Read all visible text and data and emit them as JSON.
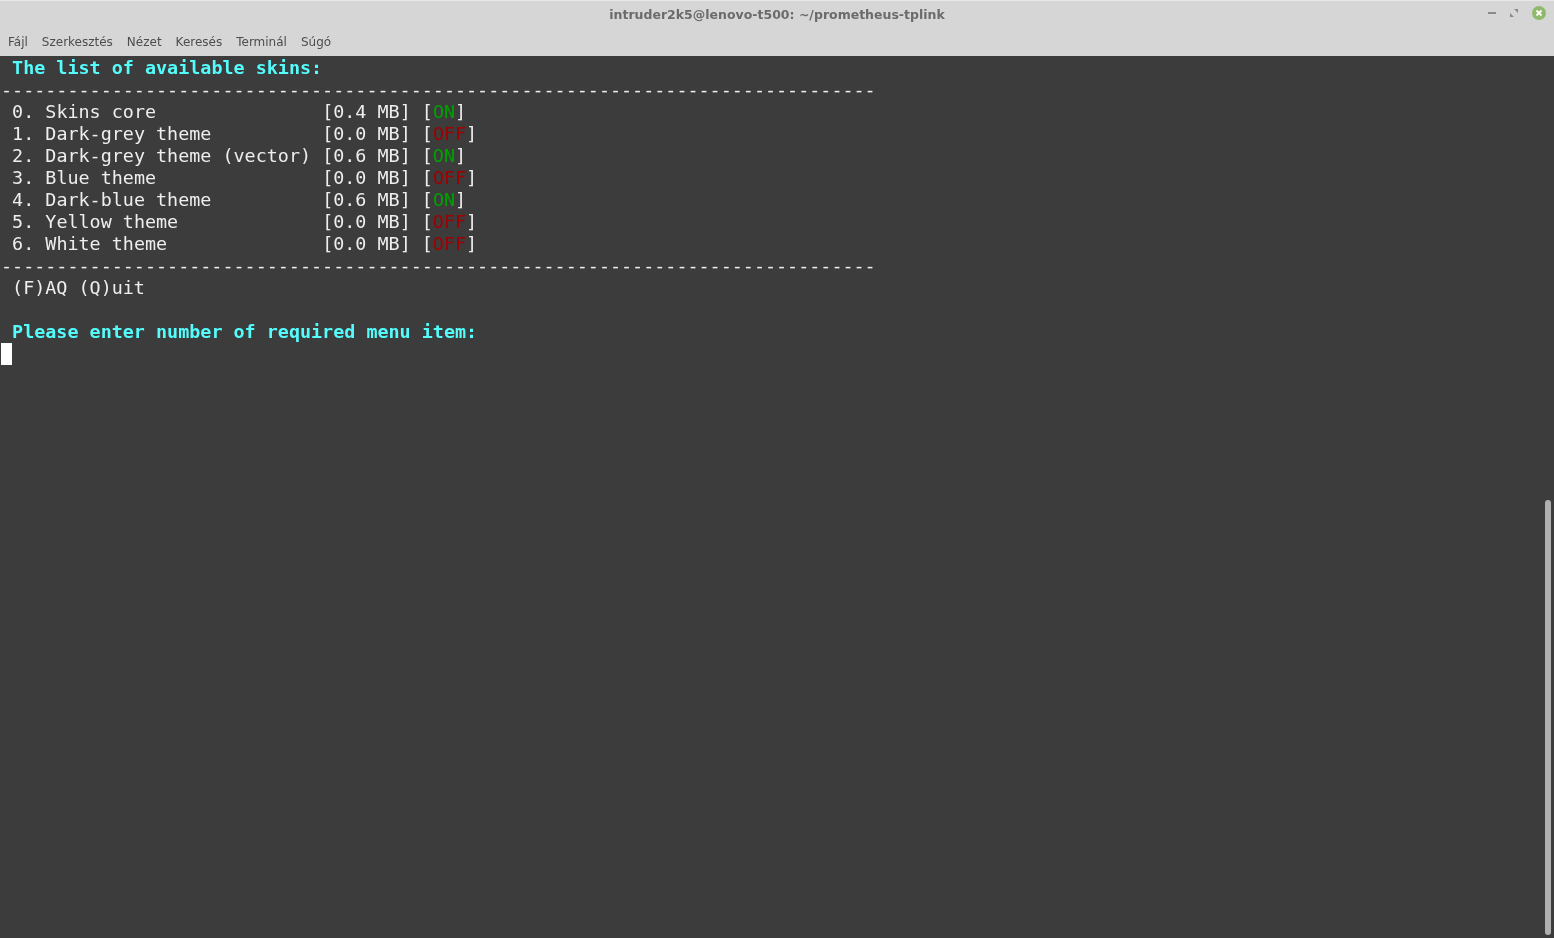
{
  "window": {
    "title": "intruder2k5@lenovo-t500: ~/prometheus-tplink"
  },
  "menu": [
    "Fájl",
    "Szerkesztés",
    "Nézet",
    "Keresés",
    "Terminál",
    "Súgó"
  ],
  "terminal": {
    "heading": "The list of available skins:",
    "separator": "-------------------------------------------------------------------------------",
    "skins": [
      {
        "number": "0.",
        "name": "Skins core",
        "size": "[0.4 MB]",
        "open": "[",
        "status": "ON",
        "close": "]",
        "on": true
      },
      {
        "number": "1.",
        "name": "Dark-grey theme",
        "size": "[0.0 MB]",
        "open": "[",
        "status": "OFF",
        "close": "]",
        "on": false
      },
      {
        "number": "2.",
        "name": "Dark-grey theme (vector)",
        "size": "[0.6 MB]",
        "open": "[",
        "status": "ON",
        "close": "]",
        "on": true
      },
      {
        "number": "3.",
        "name": "Blue theme",
        "size": "[0.0 MB]",
        "open": "[",
        "status": "OFF",
        "close": "]",
        "on": false
      },
      {
        "number": "4.",
        "name": "Dark-blue theme",
        "size": "[0.6 MB]",
        "open": "[",
        "status": "ON",
        "close": "]",
        "on": true
      },
      {
        "number": "5.",
        "name": "Yellow theme",
        "size": "[0.0 MB]",
        "open": "[",
        "status": "OFF",
        "close": "]",
        "on": false
      },
      {
        "number": "6.",
        "name": "White theme",
        "size": "[0.0 MB]",
        "open": "[",
        "status": "OFF",
        "close": "]",
        "on": false
      }
    ],
    "options": "(F)AQ (Q)uit",
    "prompt": "Please enter number of required menu item:"
  }
}
